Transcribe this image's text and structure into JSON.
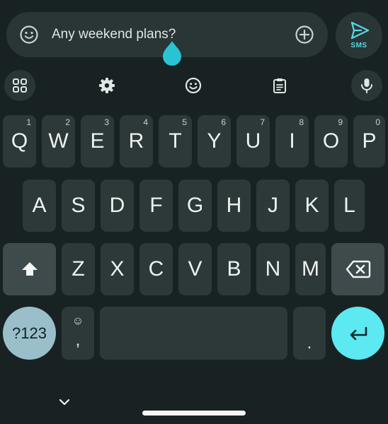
{
  "compose": {
    "text": "Any weekend plans?",
    "send_label": "SMS",
    "emoji_icon": "emoji-smile-icon",
    "add_icon": "add-circle-icon",
    "send_icon": "send-icon"
  },
  "toolbar": {
    "items": [
      {
        "icon": "apps-grid-icon"
      },
      {
        "icon": "settings-icon"
      },
      {
        "icon": "emoji-icon"
      },
      {
        "icon": "clipboard-icon"
      },
      {
        "icon": "microphone-icon"
      }
    ]
  },
  "keyboard": {
    "row1": [
      {
        "label": "Q",
        "hint": "1"
      },
      {
        "label": "W",
        "hint": "2"
      },
      {
        "label": "E",
        "hint": "3"
      },
      {
        "label": "R",
        "hint": "4"
      },
      {
        "label": "T",
        "hint": "5"
      },
      {
        "label": "Y",
        "hint": "6"
      },
      {
        "label": "U",
        "hint": "7"
      },
      {
        "label": "I",
        "hint": "8"
      },
      {
        "label": "O",
        "hint": "9"
      },
      {
        "label": "P",
        "hint": "0"
      }
    ],
    "row2": [
      "A",
      "S",
      "D",
      "F",
      "G",
      "H",
      "J",
      "K",
      "L"
    ],
    "row3": [
      "Z",
      "X",
      "C",
      "V",
      "B",
      "N",
      "M"
    ],
    "mode_label": "?123",
    "comma_top": "☺",
    "comma_label": ",",
    "period_label": "."
  },
  "colors": {
    "background": "#192223",
    "key": "#2d3839",
    "accent": "#5ce9f1",
    "mode_key": "#9abfca"
  }
}
